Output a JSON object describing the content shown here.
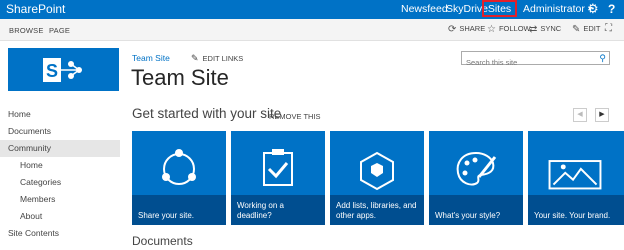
{
  "suitebar": {
    "brand": "SharePoint",
    "links": {
      "newsfeed": "Newsfeed",
      "skydrive": "SkyDrive",
      "sites": "Sites"
    },
    "user": "Administrator",
    "icons": {
      "settings": "gear-icon",
      "help": "help-icon"
    }
  },
  "ribbon": {
    "tabs": [
      "BROWSE",
      "PAGE"
    ],
    "actions": {
      "share": "SHARE",
      "follow": "FOLLOW",
      "sync": "SYNC",
      "edit": "EDIT"
    }
  },
  "header": {
    "breadcrumb": "Team Site",
    "edit_links": "EDIT LINKS",
    "title": "Team Site",
    "search_placeholder": "Search this site"
  },
  "nav": {
    "items": [
      "Home",
      "Documents",
      "Community",
      "Home",
      "Categories",
      "Members",
      "About",
      "Site Contents"
    ]
  },
  "get_started": {
    "title": "Get started with your site",
    "remove": "REMOVE THIS",
    "tiles": [
      "Share your site.",
      "Working on a deadline?",
      "Add lists, libraries, and other apps.",
      "What's your style?",
      "Your site. Your brand."
    ]
  },
  "documents": {
    "title": "Documents"
  },
  "colors": {
    "suitebar": "#0072c6",
    "tile": "#0072c6",
    "highlight": "#e3202a"
  }
}
